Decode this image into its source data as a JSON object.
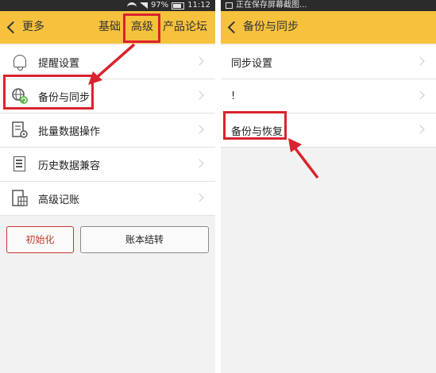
{
  "left": {
    "status": {
      "battery": "97%",
      "time": "11:12"
    },
    "toolbar": {
      "back_label": "更多",
      "tabs": [
        "基础",
        "高级",
        "产品论坛"
      ]
    },
    "menu": [
      {
        "label": "提醒设置",
        "icon": "bell-icon"
      },
      {
        "label": "备份与同步",
        "icon": "globe-sync-icon"
      },
      {
        "label": "批量数据操作",
        "icon": "checklist-gear-icon"
      },
      {
        "label": "历史数据兼容",
        "icon": "document-stack-icon"
      },
      {
        "label": "高级记账",
        "icon": "ledger-grid-icon"
      }
    ],
    "buttons": {
      "init": "初始化",
      "transfer": "账本结转"
    }
  },
  "right": {
    "status": {
      "text": "正在保存屏幕截图..."
    },
    "toolbar": {
      "back_label": "备份与同步"
    },
    "menu": [
      {
        "label": "同步设置"
      },
      {
        "label": "!"
      },
      {
        "label": "备份与恢复"
      }
    ]
  },
  "colors": {
    "toolbar": "#f6c23d",
    "highlight": "#d9232d",
    "statusbar": "#2b2b2b"
  }
}
